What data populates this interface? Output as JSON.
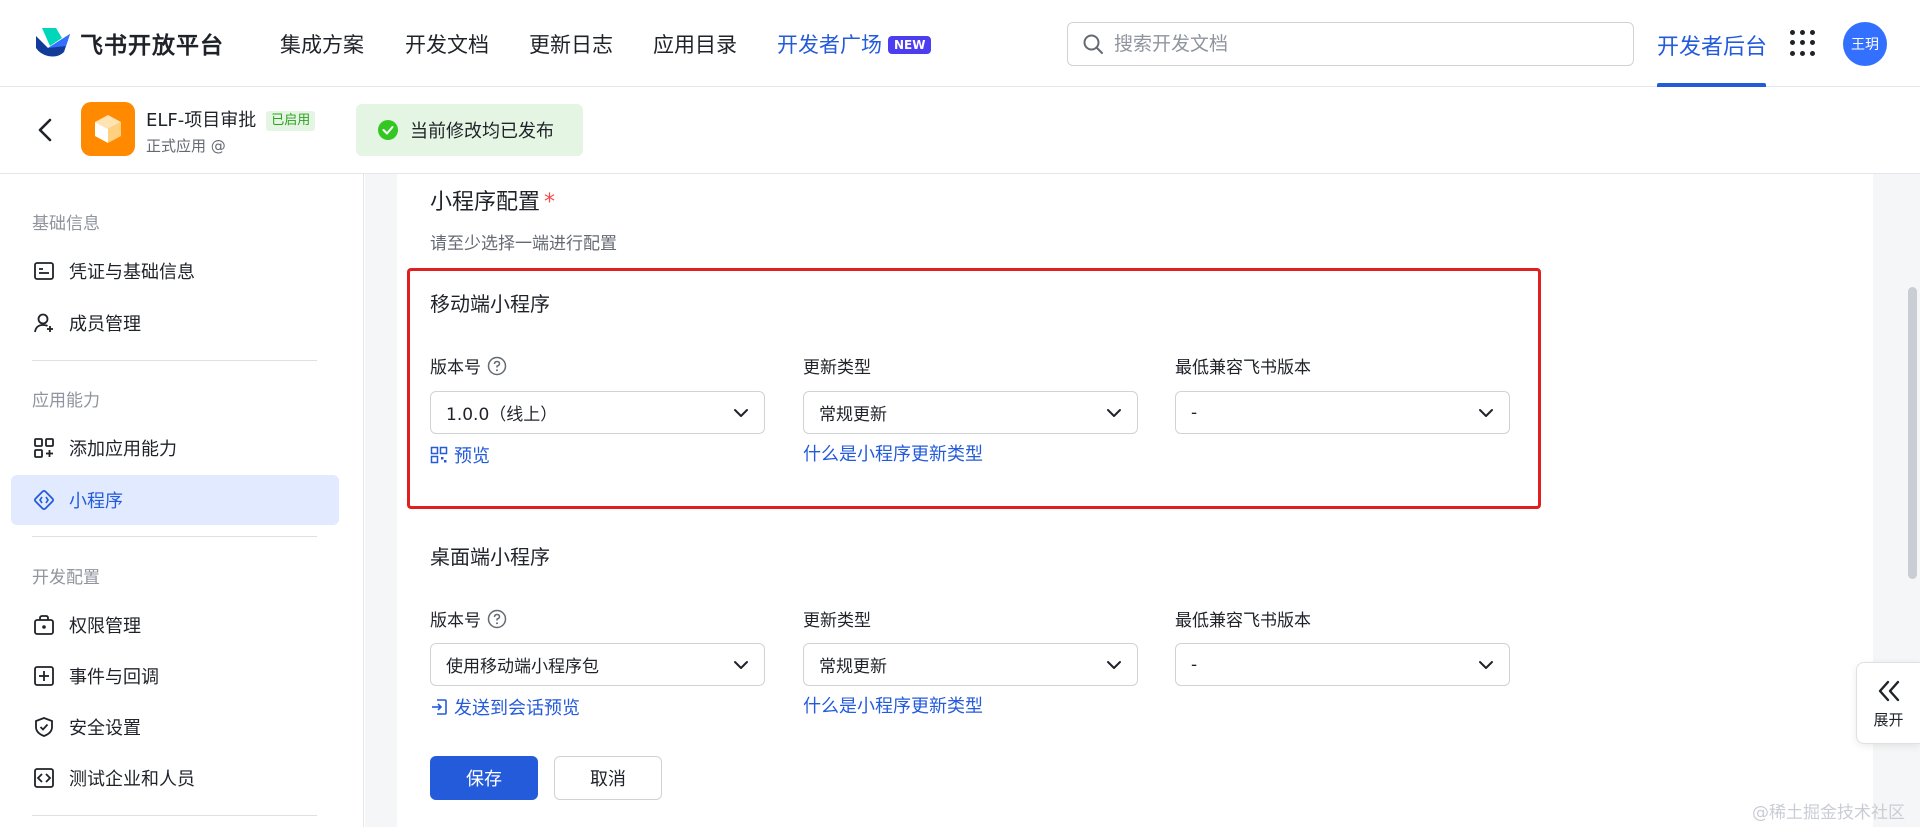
{
  "brand": {
    "name": "飞书开放平台",
    "accent": "#245bdb"
  },
  "nav": {
    "items": [
      "集成方案",
      "开发文档",
      "更新日志",
      "应用目录"
    ],
    "plaza": {
      "label": "开发者广场",
      "badge": "NEW"
    },
    "search_placeholder": "搜索开发文档",
    "backend": "开发者后台",
    "avatar": "王玥"
  },
  "app": {
    "name": "ELF-项目审批",
    "status": "已启用",
    "subtitle": "正式应用 @",
    "published": "当前修改均已发布"
  },
  "sidebar": {
    "sections": [
      {
        "title": "基础信息",
        "items": [
          {
            "label": "凭证与基础信息",
            "icon": "id-card-icon"
          },
          {
            "label": "成员管理",
            "icon": "user-add-icon"
          }
        ]
      },
      {
        "title": "应用能力",
        "items": [
          {
            "label": "添加应用能力",
            "icon": "apps-add-icon"
          },
          {
            "label": "小程序",
            "icon": "mini-program-icon",
            "active": true
          }
        ]
      },
      {
        "title": "开发配置",
        "items": [
          {
            "label": "权限管理",
            "icon": "lock-box-icon"
          },
          {
            "label": "事件与回调",
            "icon": "plus-box-icon"
          },
          {
            "label": "安全设置",
            "icon": "shield-icon"
          },
          {
            "label": "测试企业和人员",
            "icon": "code-box-icon"
          }
        ]
      }
    ]
  },
  "main": {
    "title": "小程序配置",
    "required_mark": "*",
    "description": "请至少选择一端进行配置",
    "mobile": {
      "title": "移动端小程序",
      "version_label": "版本号",
      "version_value": "1.0.0（线上）",
      "update_label": "更新类型",
      "update_value": "常规更新",
      "min_label": "最低兼容飞书版本",
      "min_value": "-",
      "preview_link": "预览",
      "update_help_link": "什么是小程序更新类型"
    },
    "desktop": {
      "title": "桌面端小程序",
      "version_label": "版本号",
      "version_value": "使用移动端小程序包",
      "update_label": "更新类型",
      "update_value": "常规更新",
      "min_label": "最低兼容飞书版本",
      "min_value": "-",
      "send_link": "发送到会话预览",
      "update_help_link": "什么是小程序更新类型"
    },
    "save_label": "保存",
    "cancel_label": "取消"
  },
  "expand_label": "展开",
  "watermark": "@稀土掘金技术社区"
}
